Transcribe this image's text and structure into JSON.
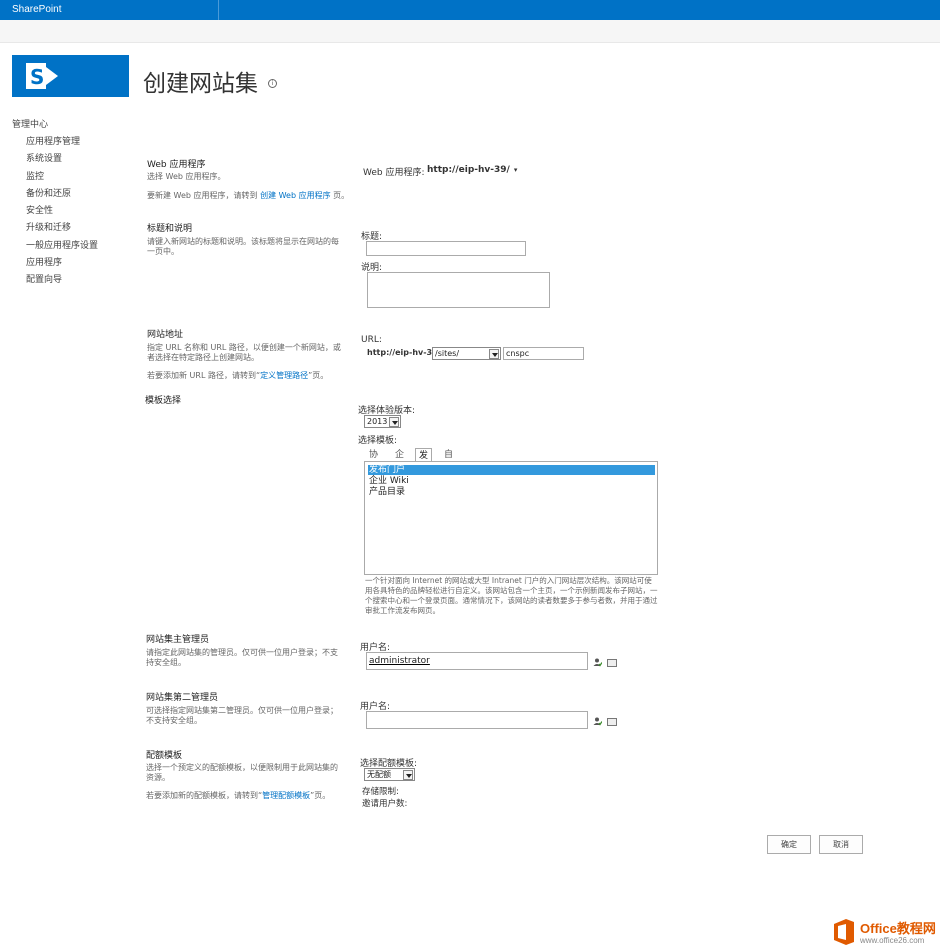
{
  "suitebar": {
    "brand": "SharePoint"
  },
  "page": {
    "title": "创建网站集",
    "info_glyph": "i"
  },
  "leftnav": {
    "root": "管理中心",
    "items": [
      "应用程序管理",
      "系统设置",
      "监控",
      "备份和还原",
      "安全性",
      "升级和迁移",
      "一般应用程序设置",
      "应用程序",
      "配置向导"
    ]
  },
  "sections": {
    "webapp": {
      "title": "Web 应用程序",
      "desc1": "选择 Web 应用程序。",
      "desc2_pre": "要新建 Web 应用程序，请转到 ",
      "desc2_link": "创建 Web 应用程序",
      "desc2_post": " 页。",
      "field_label": "Web 应用程序:",
      "field_value": "http://eip-hv-39/"
    },
    "titledesc": {
      "title": "标题和说明",
      "desc": "请键入新网站的标题和说明。该标题将显示在网站的每一页中。",
      "title_label": "标题:",
      "title_value": "",
      "desc_label": "说明:"
    },
    "address": {
      "title": "网站地址",
      "desc1": "指定 URL 名称和 URL 路径，以便创建一个新网站，或者选择在特定路径上创建网站。",
      "desc2_pre": "若要添加新 URL 路径，请转到“",
      "desc2_link": "定义管理路径",
      "desc2_post": "”页。",
      "url_label": "URL:",
      "url_prefix": "http://eip-hv-39",
      "path_value": "/sites/",
      "name_value": "cnspc"
    },
    "template": {
      "title": "模板选择",
      "version_label": "选择体验版本:",
      "version_value": "2013",
      "template_label": "选择模板:",
      "tabs": [
        "协作",
        "企业",
        "发布",
        "自定义"
      ],
      "active_tab": "发布",
      "items": [
        "发布门户",
        "企业 Wiki",
        "产品目录"
      ],
      "selected_item": "发布门户",
      "description": "一个针对面向 Internet 的网站或大型 Intranet 门户的入门网站层次结构。该网站可使用各具特色的品牌轻松进行自定义。该网站包含一个主页，一个示例新闻发布子网站，一个搜索中心和一个登录页面。通常情况下，该网站的读者数要多于参与者数，并用于通过审批工作流发布网页。"
    },
    "primary_admin": {
      "title": "网站集主管理员",
      "desc": "请指定此网站集的管理员。仅可供一位用户登录；不支持安全组。",
      "user_label": "用户名:",
      "user_value": "administrator"
    },
    "secondary_admin": {
      "title": "网站集第二管理员",
      "desc": "可选择指定网站集第二管理员。仅可供一位用户登录；不支持安全组。",
      "user_label": "用户名:",
      "user_value": ""
    },
    "quota": {
      "title": "配额模板",
      "desc1": "选择一个预定义的配额模板，以便限制用于此网站集的资源。",
      "desc2_pre": "若要添加新的配额模板，请转到“",
      "desc2_link": "管理配额模板",
      "desc2_post": "”页。",
      "quota_label": "选择配额模板:",
      "quota_value": "无配额",
      "storage_label": "存储限制:",
      "invite_label": "邀请用户数:"
    }
  },
  "buttons": {
    "ok": "确定",
    "cancel": "取消"
  },
  "watermark": {
    "text": "Office教程网",
    "url": "www.office26.com"
  },
  "colors": {
    "suitebar": "#0072c6",
    "link": "#0072c6",
    "selected": "#3399dd",
    "watermark": "#e05a00"
  }
}
